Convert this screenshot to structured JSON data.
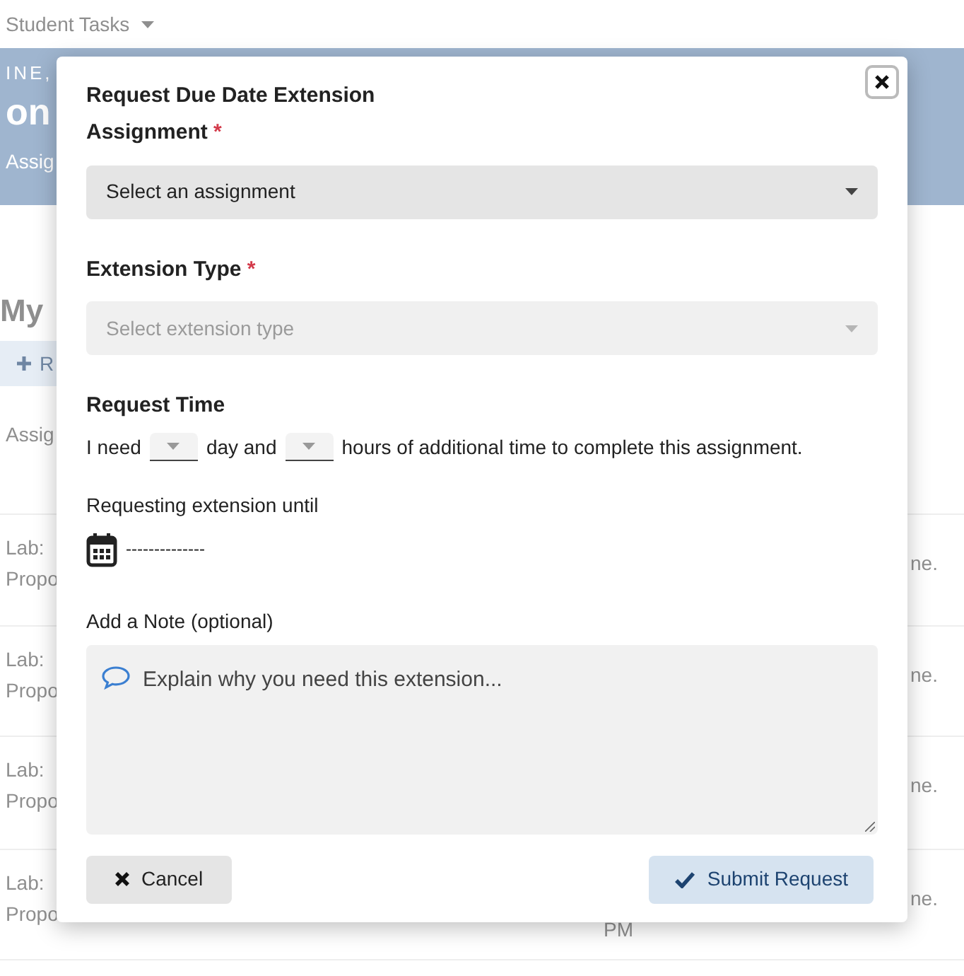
{
  "background": {
    "nav_item": "Student Tasks",
    "band_kicker": "INE,",
    "band_heading": "on",
    "band_tab": "Assig",
    "page_heading": "My",
    "add_button": "R",
    "table_header": "Assig",
    "rows": [
      {
        "line_1": "Lab:",
        "line_2": "Propo",
        "right": "ne."
      },
      {
        "line_1": "Lab:",
        "line_2": "Propo",
        "right": "ne."
      },
      {
        "line_1": "Lab:",
        "line_2": "Propo",
        "right": "ne."
      },
      {
        "line_1": "Lab:",
        "line_2": "Propo",
        "right": "ne.",
        "extra": "PM"
      }
    ]
  },
  "modal": {
    "title": "Request Due Date Extension",
    "assignment": {
      "label": "Assignment",
      "required_mark": "*",
      "value": "Select an assignment",
      "disabled": false
    },
    "extension_type": {
      "label": "Extension Type",
      "required_mark": "*",
      "placeholder": "Select extension type",
      "disabled": true
    },
    "request_time": {
      "label": "Request Time",
      "text_1": "I need",
      "text_2": "day and",
      "text_3": "hours of additional time to complete this assignment."
    },
    "until": {
      "label": "Requesting extension until",
      "value": "--------------"
    },
    "note": {
      "label": "Add a Note (optional)",
      "placeholder": "Explain why you need this extension..."
    },
    "buttons": [
      {
        "kind": "cancel",
        "label": "Cancel"
      },
      {
        "kind": "submit",
        "label": "Submit Request"
      }
    ]
  }
}
